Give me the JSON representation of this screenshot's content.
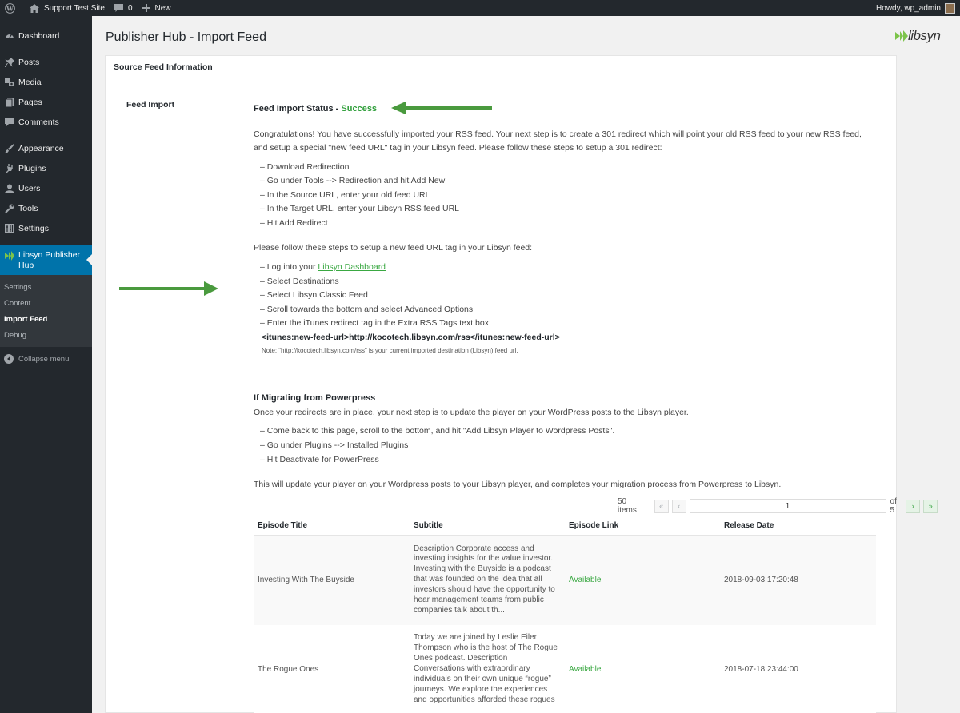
{
  "admin_bar": {
    "site_name": "Support Test Site",
    "comment_count": "0",
    "new_label": "New",
    "howdy": "Howdy, wp_admin"
  },
  "sidebar": {
    "items": [
      {
        "label": "Dashboard",
        "icon": "dashboard-icon"
      },
      {
        "label": "Posts",
        "icon": "pin-icon"
      },
      {
        "label": "Media",
        "icon": "media-icon"
      },
      {
        "label": "Pages",
        "icon": "pages-icon"
      },
      {
        "label": "Comments",
        "icon": "comment-icon"
      },
      {
        "label": "Appearance",
        "icon": "brush-icon"
      },
      {
        "label": "Plugins",
        "icon": "plugin-icon"
      },
      {
        "label": "Users",
        "icon": "user-icon"
      },
      {
        "label": "Tools",
        "icon": "wrench-icon"
      },
      {
        "label": "Settings",
        "icon": "settings-icon"
      },
      {
        "label": "Libsyn Publisher Hub",
        "icon": "libsyn-icon"
      }
    ],
    "submenu": [
      "Settings",
      "Content",
      "Import Feed",
      "Debug"
    ],
    "collapse_label": "Collapse menu"
  },
  "page": {
    "title": "Publisher Hub - Import Feed",
    "logo_text": "libsyn",
    "panel_title": "Source Feed Information",
    "feed_import_label": "Feed Import"
  },
  "content": {
    "status_prefix": "Feed Import Status - ",
    "status_value": "Success",
    "intro": "Congratulations! You have successfully imported your RSS feed. Your next step is to create a 301 redirect which will point your old RSS feed to your new RSS feed, and setup a special \"new feed URL\" tag in your Libsyn feed. Please follow these steps to setup a 301 redirect:",
    "redirect_steps": [
      "– Download Redirection",
      "– Go under Tools --> Redirection and hit Add New",
      "– In the Source URL, enter your old feed URL",
      "– In the Target URL, enter your Libsyn RSS feed URL",
      "– Hit Add Redirect"
    ],
    "tag_intro": "Please follow these steps to setup a new feed URL tag in your Libsyn feed:",
    "login_prefix": "– Log into your ",
    "login_link": "Libsyn Dashboard",
    "tag_steps": [
      "– Select Destinations",
      "– Select Libsyn Classic Feed",
      "– Scroll towards the bottom and select Advanced Options",
      "– Enter the iTunes redirect tag in the Extra RSS Tags text box:"
    ],
    "itunes_tag": "<itunes:new-feed-url>http://kocotech.libsyn.com/rss</itunes:new-feed-url>",
    "note": "Note: “http://kocotech.libsyn.com/rss” is your current imported destination (Libsyn) feed url.",
    "migrate_title": "If Migrating from Powerpress",
    "migrate_intro": "Once your redirects are in place, your next step is to update the player on your WordPress posts to the Libsyn player.",
    "migrate_steps": [
      "– Come back to this page, scroll to the bottom, and hit \"Add Libsyn Player to Wordpress Posts\".",
      "– Go under Plugins --> Installed Plugins",
      "– Hit Deactivate for PowerPress"
    ],
    "migrate_outro": "This will update your player on your Wordpress posts to your Libsyn player, and completes your migration process from Powerpress to Libsyn."
  },
  "pagination": {
    "items": "50 items",
    "current_page": "1",
    "of_pages": "of 5",
    "first": "«",
    "prev": "‹",
    "next": "›",
    "last": "»"
  },
  "table": {
    "columns": [
      "Episode Title",
      "Subtitle",
      "Episode Link",
      "Release Date"
    ],
    "rows": [
      {
        "title": "Investing With The Buyside",
        "subtitle": "Description Corporate access and investing insights for the value investor. Investing with the Buyside is a podcast that was founded on the idea that all investors should have the opportunity to hear management teams from public companies talk about th...",
        "link": "Available",
        "date": "2018-09-03 17:20:48"
      },
      {
        "title": "The Rogue Ones",
        "subtitle": "Today we are joined by Leslie Eiler Thompson who is the host of The Rogue Ones podcast. Description Conversations with extraordinary individuals on their own unique “rogue” journeys. We explore the experiences and opportunities afforded these rogues",
        "link": "Available",
        "date": "2018-07-18 23:44:00"
      }
    ]
  },
  "colors": {
    "accent_green": "#3aa842",
    "arrow_green": "#4a9a3e",
    "wp_blue": "#0073aa",
    "sidebar_bg": "#23282d"
  }
}
